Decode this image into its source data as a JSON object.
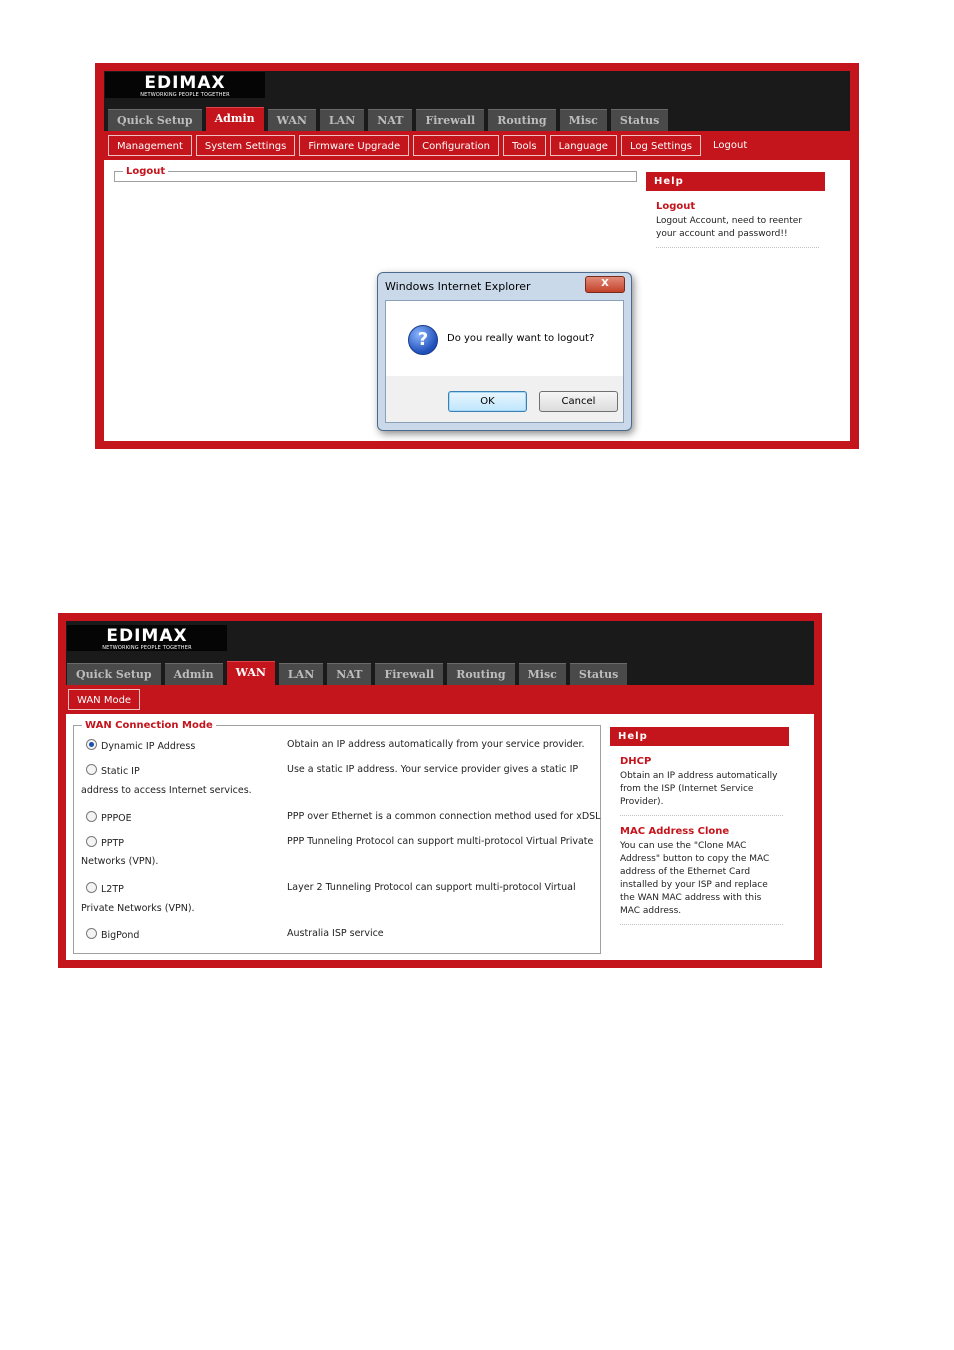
{
  "brand": {
    "name": "EDIMAX",
    "tagline": "NETWORKING PEOPLE TOGETHER"
  },
  "screen1": {
    "tabs": [
      "Quick Setup",
      "Admin",
      "WAN",
      "LAN",
      "NAT",
      "Firewall",
      "Routing",
      "Misc",
      "Status"
    ],
    "active_tab": "Admin",
    "subtabs": [
      "Management",
      "System Settings",
      "Firmware Upgrade",
      "Configuration",
      "Tools",
      "Language",
      "Log Settings",
      "Logout"
    ],
    "section_title": "Logout",
    "help": {
      "header": "Help",
      "title": "Logout",
      "text": "Logout Account, need to reenter your account and password!!"
    },
    "dialog": {
      "title": "Windows Internet Explorer",
      "close_glyph": "X",
      "message": "Do you really want to logout?",
      "ok_label": "OK",
      "cancel_label": "Cancel"
    }
  },
  "screen2": {
    "tabs": [
      "Quick Setup",
      "Admin",
      "WAN",
      "LAN",
      "NAT",
      "Firewall",
      "Routing",
      "Misc",
      "Status"
    ],
    "active_tab": "WAN",
    "subtabs": [
      "WAN Mode"
    ],
    "section_title": "WAN Connection Mode",
    "modes": [
      {
        "label": "Dynamic IP Address",
        "checked": true,
        "desc": "Obtain an IP address automatically from your service provider.",
        "desc_cont": ""
      },
      {
        "label": "Static IP",
        "checked": false,
        "desc": "Use a static IP address. Your service provider gives a static IP",
        "desc_cont": "address to access Internet services."
      },
      {
        "label": "PPPOE",
        "checked": false,
        "desc": "PPP over Ethernet is a common connection method used for xDSL",
        "desc_cont": ""
      },
      {
        "label": "PPTP",
        "checked": false,
        "desc": "PPP Tunneling Protocol can support multi-protocol Virtual Private",
        "desc_cont": "Networks (VPN)."
      },
      {
        "label": "L2TP",
        "checked": false,
        "desc": "Layer 2 Tunneling Protocol can support multi-protocol Virtual",
        "desc_cont": "Private Networks (VPN)."
      },
      {
        "label": "BigPond",
        "checked": false,
        "desc": "Australia ISP service",
        "desc_cont": ""
      }
    ],
    "help": {
      "header": "Help",
      "items": [
        {
          "title": "DHCP",
          "text": "Obtain an IP address automatically from the ISP (Internet Service Provider)."
        },
        {
          "title": "MAC Address Clone",
          "text": "You can use the \"Clone MAC Address\" button to copy the MAC address of the Ethernet Card installed by your ISP and replace the WAN MAC address with this MAC address."
        }
      ]
    }
  }
}
